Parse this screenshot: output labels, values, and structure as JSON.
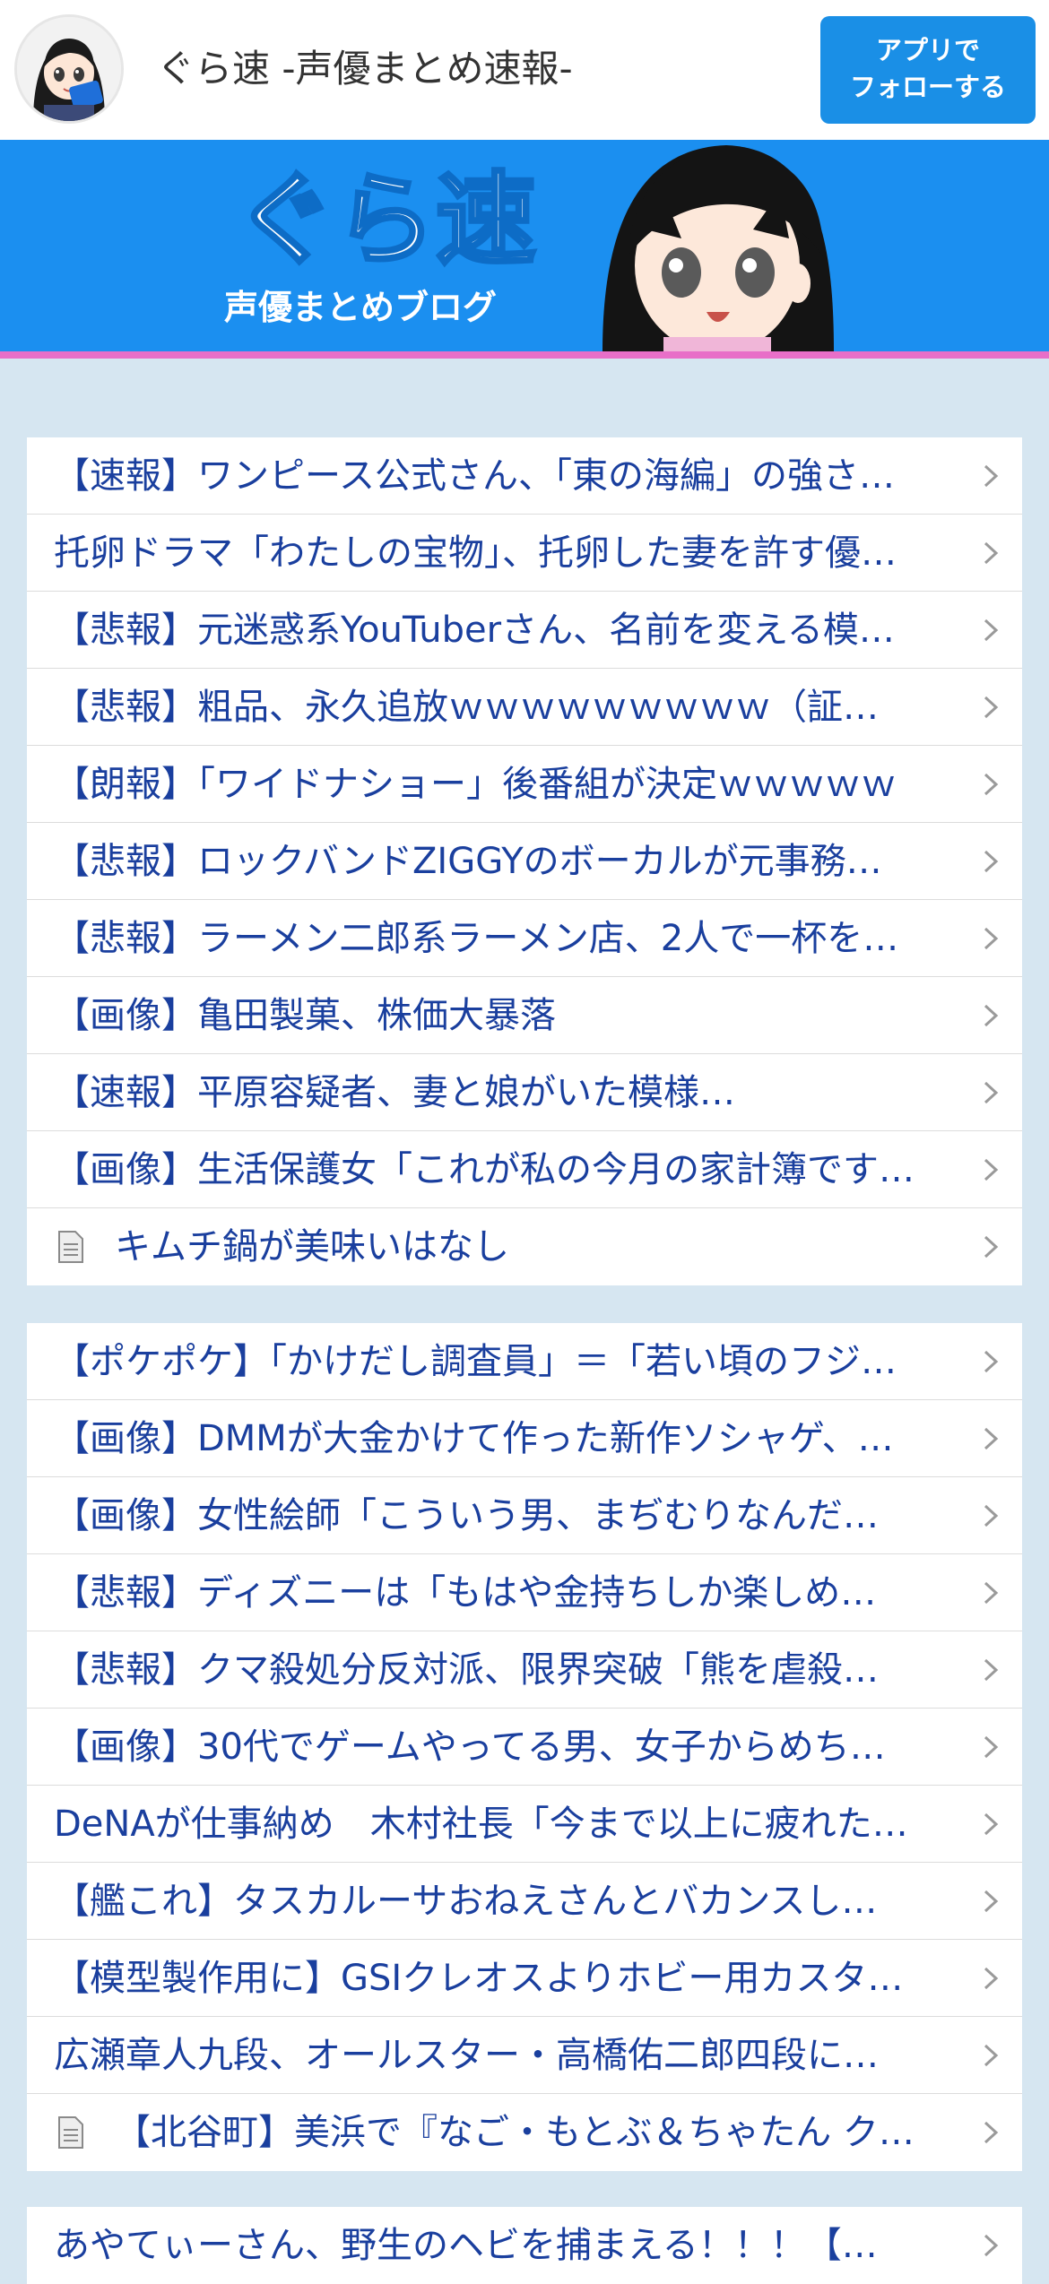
{
  "header": {
    "site_title": "ぐら速  -声優まとめ速報-",
    "follow_button": [
      "アプリで",
      "フォローする"
    ]
  },
  "banner": {
    "logo_text": "ぐら速",
    "sub_text": "声優まとめブログ"
  },
  "colors": {
    "accent": "#1a8fe6",
    "banner_bg": "#1b8ff0",
    "stripe": "#e86fc8",
    "link_text": "#1a3f9e",
    "page_bg": "#d6e6f1"
  },
  "sections": [
    {
      "items": [
        {
          "text": "【速報】ワンピース公式さん、「東の海編」の強さ…",
          "icon": null
        },
        {
          "text": "托卵ドラマ「わたしの宝物」、托卵した妻を許す優…",
          "icon": null
        },
        {
          "text": "【悲報】元迷惑系YouTuberさん、名前を変える模…",
          "icon": null
        },
        {
          "text": "【悲報】粗品、永久追放ｗｗｗｗｗｗｗｗｗ（証…",
          "icon": null
        },
        {
          "text": "【朗報】「ワイドナショー」後番組が決定ｗｗｗｗｗ",
          "icon": null
        },
        {
          "text": "【悲報】ロックバンドZIGGYのボーカルが元事務…",
          "icon": null
        },
        {
          "text": "【悲報】ラーメン二郎系ラーメン店、2人で一杯を…",
          "icon": null
        },
        {
          "text": "【画像】亀田製菓、株価大暴落",
          "icon": null
        },
        {
          "text": "【速報】平原容疑者、妻と娘がいた模様…",
          "icon": null
        },
        {
          "text": "【画像】生活保護女「これが私の今月の家計簿です…",
          "icon": null
        },
        {
          "text": "キムチ鍋が美味いはなし",
          "icon": "document-icon"
        }
      ]
    },
    {
      "items": [
        {
          "text": "【ポケポケ】「かけだし調査員」＝「若い頃のフジ…",
          "icon": null
        },
        {
          "text": "【画像】DMMが大金かけて作った新作ソシャゲ、…",
          "icon": null
        },
        {
          "text": "【画像】女性絵師「こういう男、まぢむりなんだ…",
          "icon": null
        },
        {
          "text": "【悲報】ディズニーは「もはや金持ちしか楽しめ…",
          "icon": null
        },
        {
          "text": "【悲報】クマ殺処分反対派、限界突破「熊を虐殺…",
          "icon": null
        },
        {
          "text": "【画像】30代でゲームやってる男、女子からめち…",
          "icon": null
        },
        {
          "text": "DeNAが仕事納め　木村社長「今まで以上に疲れた…",
          "icon": null
        },
        {
          "text": "【艦これ】タスカルーサおねえさんとバカンスし…",
          "icon": null
        },
        {
          "text": "【模型製作用に】GSIクレオスよりホビー用カスタ…",
          "icon": null
        },
        {
          "text": "広瀬章人九段、オールスター・高橋佑二郎四段に…",
          "icon": null
        },
        {
          "text": "【北谷町】美浜で『なご・もとぶ＆ちゃたん ク…",
          "icon": "document-icon"
        }
      ]
    },
    {
      "items": [
        {
          "text": "あやてぃーさん、野生のヘビを捕まえる！！！【…",
          "icon": null
        }
      ]
    }
  ]
}
